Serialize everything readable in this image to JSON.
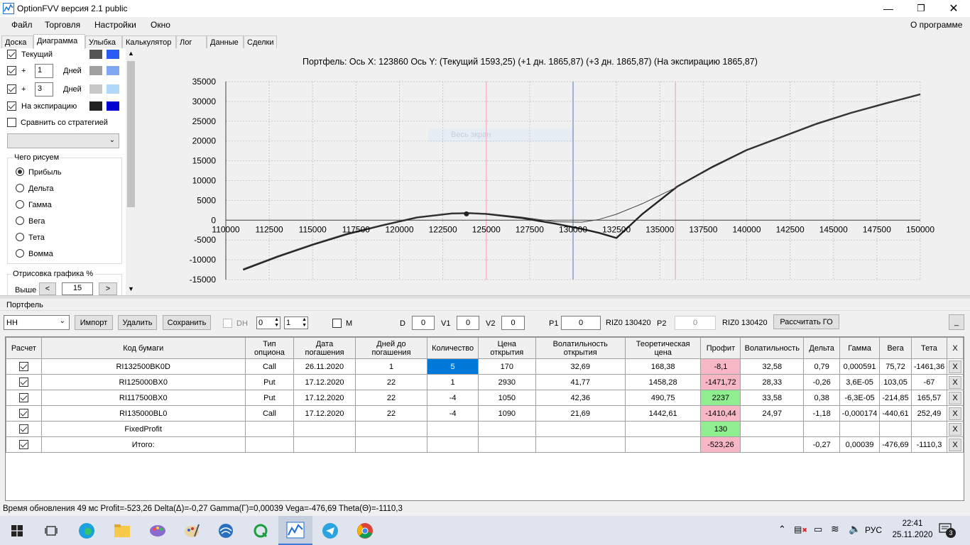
{
  "window": {
    "title": "OptionFVV версия 2.1 public"
  },
  "menu": {
    "items": [
      "Файл",
      "Торговля",
      "Настройки",
      "Окно"
    ],
    "about": "О программе"
  },
  "tabs": [
    "Доска",
    "Диаграмма",
    "Улыбка",
    "Калькулятор",
    "Лог",
    "Данные",
    "Сделки"
  ],
  "left_panel": {
    "current_label": "Текущий",
    "plus1": {
      "sign": "+",
      "value": "1",
      "unit": "Дней"
    },
    "plus3": {
      "sign": "+",
      "value": "3",
      "unit": "Дней"
    },
    "expiration_label": "На экспирацию",
    "compare_label": "Сравнить со стратегией",
    "draw_group_title": "Чего рисуем",
    "draw_options": [
      "Прибыль",
      "Дельта",
      "Гамма",
      "Вега",
      "Тета",
      "Вомма"
    ],
    "draw_selected": "Прибыль",
    "render_group_title": "Отрисовка графика %",
    "above_label": "Выше",
    "above_value": "15",
    "colors": {
      "current": [
        "#555555",
        "#2a5cf5"
      ],
      "plus1": [
        "#a0a0a0",
        "#7fa8f0"
      ],
      "plus3": [
        "#c8c8c8",
        "#b0d8f8"
      ],
      "expiration": [
        "#222222",
        "#0000d0"
      ]
    }
  },
  "chart_header": {
    "text": "Портфель: Ось X: 123860 Ось Y:  (Текущий 1593,25)  (+1 дн. 1865,87)  (+3 дн. 1865,87)  (На экспирацию 1865,87)"
  },
  "fullscreen_hint": "Весь экран",
  "chart_data": {
    "type": "line",
    "xlim": [
      110000,
      150000
    ],
    "ylim": [
      -15000,
      35000
    ],
    "x_ticks": [
      110000,
      112500,
      115000,
      117500,
      120000,
      122500,
      125000,
      127500,
      130000,
      132500,
      135000,
      137500,
      140000,
      142500,
      145000,
      147500,
      150000
    ],
    "y_ticks": [
      35000,
      30000,
      25000,
      20000,
      15000,
      10000,
      5000,
      0,
      -5000,
      -10000,
      -15000
    ],
    "grid": true,
    "vertical_markers": [
      {
        "x": 125000,
        "color": "#f2b8c6"
      },
      {
        "x": 130000,
        "color": "#7f9fc8"
      },
      {
        "x": 135900,
        "color": "#f2b8c6"
      }
    ],
    "current_point": {
      "x": 123860,
      "y": 1593.25
    },
    "series": [
      {
        "x": [
          111000,
          113000,
          115000,
          117000,
          119000,
          121000,
          123000,
          124000,
          125000,
          127000,
          129000,
          130500,
          131500,
          132500,
          134000,
          136000,
          138000,
          140000,
          142000,
          144000,
          146000,
          148000,
          150000
        ],
        "values": [
          -12500,
          -9200,
          -6200,
          -3500,
          -1300,
          700,
          1700,
          1800,
          1600,
          600,
          -900,
          -2200,
          -3200,
          -4500,
          1600,
          8500,
          13400,
          17700,
          21000,
          24300,
          27100,
          29500,
          31800
        ],
        "color": "#222222",
        "width": 2.4
      },
      {
        "x": [
          111000,
          113000,
          115000,
          117000,
          119000,
          121000,
          123000,
          124000,
          125000,
          127000,
          129000,
          130500,
          131500,
          132500,
          134000,
          136000,
          138000,
          140000,
          142000,
          144000,
          146000,
          148000,
          150000
        ],
        "values": [
          -12300,
          -9000,
          -6000,
          -3300,
          -1200,
          800,
          1800,
          1900,
          1700,
          800,
          -400,
          -500,
          200,
          1500,
          4200,
          8400,
          13200,
          17600,
          21000,
          24300,
          27100,
          29500,
          31800
        ],
        "color": "#444444",
        "width": 1
      }
    ]
  },
  "portfolio": {
    "title": "Портфель",
    "name": "НН",
    "buttons": {
      "import": "Импорт",
      "delete": "Удалить",
      "save": "Сохранить",
      "calc_go": "Рассчитать ГО",
      "minimize": "_"
    },
    "dh_label": "DH",
    "dh_values": [
      "0",
      "1"
    ],
    "m_label": "M",
    "d_label": "D",
    "d_value": "0",
    "v1_label": "V1",
    "v1_value": "0",
    "v2_label": "V2",
    "v2_value": "0",
    "p1_label": "P1",
    "p1_value": "0",
    "riz1": "RIZ0 130420",
    "p2_label": "P2",
    "p2_value": "0",
    "riz2": "RIZ0 130420"
  },
  "table": {
    "headers": [
      "Расчет",
      "Код бумаги",
      "Тип опциона",
      "Дата погашения",
      "Дней до погашения",
      "Количество",
      "Цена открытия",
      "Волатильность открытия",
      "Теоретическая цена",
      "Профит",
      "Волатильность",
      "Дельта",
      "Гамма",
      "Вега",
      "Тета",
      "X"
    ],
    "rows": [
      {
        "code": "RI132500BK0D",
        "type": "Call",
        "date": "26.11.2020",
        "days": "1",
        "qty": "5",
        "price": "170",
        "vol_open": "32,69",
        "theo": "168,38",
        "profit": "-8,1",
        "vol": "32,58",
        "delta": "0,79",
        "gamma": "0,000591",
        "vega": "75,72",
        "theta": "-1461,36",
        "x": "X"
      },
      {
        "code": "RI125000BX0",
        "type": "Put",
        "date": "17.12.2020",
        "days": "22",
        "qty": "1",
        "price": "2930",
        "vol_open": "41,77",
        "theo": "1458,28",
        "profit": "-1471,72",
        "vol": "28,33",
        "delta": "-0,26",
        "gamma": "3,6E-05",
        "vega": "103,05",
        "theta": "-67",
        "x": "X"
      },
      {
        "code": "RI117500BX0",
        "type": "Put",
        "date": "17.12.2020",
        "days": "22",
        "qty": "-4",
        "price": "1050",
        "vol_open": "42,36",
        "theo": "490,75",
        "profit": "2237",
        "vol": "33,58",
        "delta": "0,38",
        "gamma": "-6,3E-05",
        "vega": "-214,85",
        "theta": "165,57",
        "x": "X"
      },
      {
        "code": "RI135000BL0",
        "type": "Call",
        "date": "17.12.2020",
        "days": "22",
        "qty": "-4",
        "price": "1090",
        "vol_open": "21,69",
        "theo": "1442,61",
        "profit": "-1410,44",
        "vol": "24,97",
        "delta": "-1,18",
        "gamma": "-0,000174",
        "vega": "-440,61",
        "theta": "252,49",
        "x": "X"
      },
      {
        "code": "FixedProfit",
        "type": "",
        "date": "",
        "days": "",
        "qty": "",
        "price": "",
        "vol_open": "",
        "theo": "",
        "profit": "130",
        "vol": "",
        "delta": "",
        "gamma": "",
        "vega": "",
        "theta": "",
        "x": "X"
      },
      {
        "code": "Итого:",
        "type": "",
        "date": "",
        "days": "",
        "qty": "",
        "price": "",
        "vol_open": "",
        "theo": "",
        "profit": "-523,26",
        "vol": "",
        "delta": "-0,27",
        "gamma": "0,00039",
        "vega": "-476,69",
        "theta": "-1110,3",
        "x": "X"
      }
    ],
    "profit_colors": {
      "negative": "#f7b7c4",
      "positive": "#90ee90"
    },
    "selected_color": "#0078d7"
  },
  "status": {
    "text": "Время обновления 49 мс  Profit=-523,26 Delta(Δ)=-0,27 Gamma(Γ)=0,00039 Vega=-476,69 Theta(Θ)=-1110,3"
  },
  "taskbar": {
    "lang": "РУС",
    "time": "22:41",
    "date": "25.11.2020",
    "notif_count": "3"
  }
}
